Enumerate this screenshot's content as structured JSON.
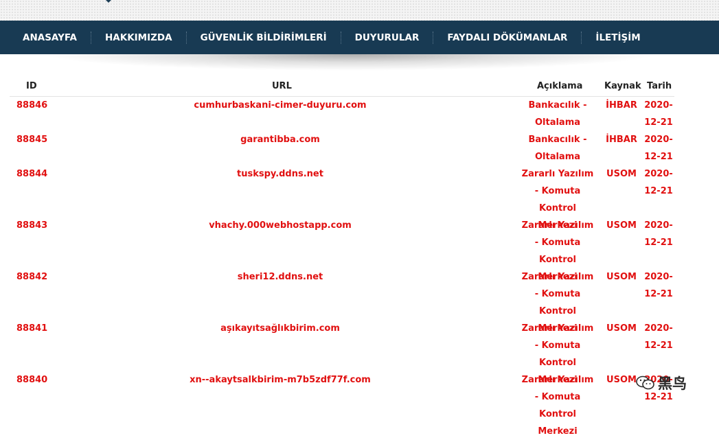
{
  "nav": {
    "items": [
      {
        "label": "ANASAYFA"
      },
      {
        "label": "HAKKIMIZDA"
      },
      {
        "label": "GÜVENLİK BİLDİRİMLERİ"
      },
      {
        "label": "DUYURULAR"
      },
      {
        "label": "FAYDALI DÖKÜMANLAR"
      },
      {
        "label": "İLETİŞİM"
      }
    ]
  },
  "table": {
    "headers": {
      "id": "ID",
      "url": "URL",
      "desc": "Açıklama",
      "source": "Kaynak",
      "date": "Tarih"
    },
    "rows": [
      {
        "id": "88846",
        "url": "cumhurbaskani-cimer-duyuru.com",
        "desc": "Bankacılık - Oltalama",
        "source": "İHBAR",
        "date": "2020-12-21"
      },
      {
        "id": "88845",
        "url": "garantibba.com",
        "desc": "Bankacılık - Oltalama",
        "source": "İHBAR",
        "date": "2020-12-21"
      },
      {
        "id": "88844",
        "url": "tuskspy.ddns.net",
        "desc": "Zararlı Yazılım - Komuta Kontrol Merkezi",
        "source": "USOM",
        "date": "2020-12-21"
      },
      {
        "id": "88843",
        "url": "vhachy.000webhostapp.com",
        "desc": "Zararlı Yazılım - Komuta Kontrol Merkezi",
        "source": "USOM",
        "date": "2020-12-21"
      },
      {
        "id": "88842",
        "url": "sheri12.ddns.net",
        "desc": "Zararlı Yazılım - Komuta Kontrol Merkezi",
        "source": "USOM",
        "date": "2020-12-21"
      },
      {
        "id": "88841",
        "url": "aşıkayıtsağlıkbirim.com",
        "desc": "Zararlı Yazılım - Komuta Kontrol Merkezi",
        "source": "USOM",
        "date": "2020-12-21"
      },
      {
        "id": "88840",
        "url": "xn--akaytsalkbirim-m7b5zdf77f.com",
        "desc": "Zararlı Yazılım - Komuta Kontrol Merkezi",
        "source": "USOM",
        "date": "2020-12-21"
      }
    ]
  },
  "watermark": {
    "text": "黑鸟",
    "icon": "wechat-icon"
  },
  "colors": {
    "nav_bg": "#183a53",
    "link_red": "#e11010"
  }
}
